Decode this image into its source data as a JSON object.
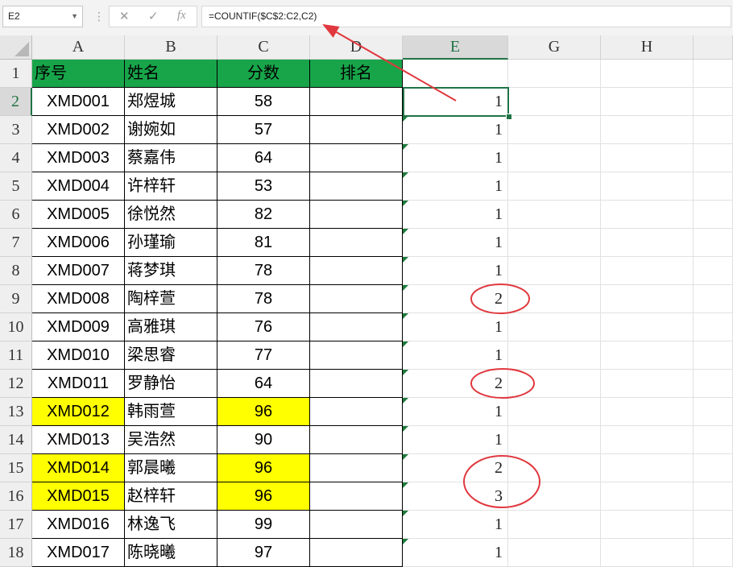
{
  "formula_bar": {
    "name_box": "E2",
    "cancel_icon": "✕",
    "enter_icon": "✓",
    "fx_label": "fx",
    "formula": "=COUNTIF($C$2:C2,C2)"
  },
  "columns": [
    "A",
    "B",
    "C",
    "D",
    "E",
    "G",
    "H"
  ],
  "selected_cell": "E2",
  "header_row": [
    "序号",
    "姓名",
    "分数",
    "排名"
  ],
  "rows": [
    {
      "num": "2",
      "id": "XMD001",
      "name": "郑煜城",
      "score": "58",
      "e": "1"
    },
    {
      "num": "3",
      "id": "XMD002",
      "name": "谢婉如",
      "score": "57",
      "e": "1"
    },
    {
      "num": "4",
      "id": "XMD003",
      "name": "蔡嘉伟",
      "score": "64",
      "e": "1"
    },
    {
      "num": "5",
      "id": "XMD004",
      "name": "许梓轩",
      "score": "53",
      "e": "1"
    },
    {
      "num": "6",
      "id": "XMD005",
      "name": "徐悦然",
      "score": "82",
      "e": "1"
    },
    {
      "num": "7",
      "id": "XMD006",
      "name": "孙瑾瑜",
      "score": "81",
      "e": "1"
    },
    {
      "num": "8",
      "id": "XMD007",
      "name": "蒋梦琪",
      "score": "78",
      "e": "1"
    },
    {
      "num": "9",
      "id": "XMD008",
      "name": "陶梓萱",
      "score": "78",
      "e": "2"
    },
    {
      "num": "10",
      "id": "XMD009",
      "name": "高雅琪",
      "score": "76",
      "e": "1"
    },
    {
      "num": "11",
      "id": "XMD010",
      "name": "梁思睿",
      "score": "77",
      "e": "1"
    },
    {
      "num": "12",
      "id": "XMD011",
      "name": "罗静怡",
      "score": "64",
      "e": "2"
    },
    {
      "num": "13",
      "id": "XMD012",
      "name": "韩雨萱",
      "score": "96",
      "e": "1",
      "highlight": true
    },
    {
      "num": "14",
      "id": "XMD013",
      "name": "吴浩然",
      "score": "90",
      "e": "1"
    },
    {
      "num": "15",
      "id": "XMD014",
      "name": "郭晨曦",
      "score": "96",
      "e": "2",
      "highlight": true
    },
    {
      "num": "16",
      "id": "XMD015",
      "name": "赵梓轩",
      "score": "96",
      "e": "3",
      "highlight": true
    },
    {
      "num": "17",
      "id": "XMD016",
      "name": "林逸飞",
      "score": "99",
      "e": "1"
    },
    {
      "num": "18",
      "id": "XMD017",
      "name": "陈晓曦",
      "score": "97",
      "e": "1"
    }
  ],
  "colors": {
    "header_fill": "#18a54a",
    "highlight_fill": "#ffff00",
    "annotation": "#e0383e",
    "selection": "#217346"
  }
}
